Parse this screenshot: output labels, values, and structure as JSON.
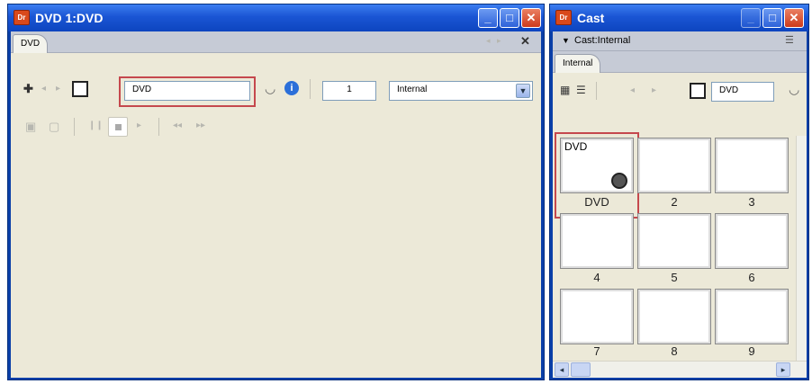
{
  "left_window": {
    "title": "DVD 1:DVD",
    "tab": "DVD",
    "name_field": "DVD",
    "number_field": "1",
    "cast_select": "Internal",
    "icons": [
      "plus-icon",
      "back-arrow-icon",
      "forward-arrow-icon",
      "sprite-square-icon",
      "eye-icon",
      "info-icon",
      "chevron-down-icon",
      "page-icon",
      "frame-icon",
      "pause-icon",
      "stop-icon",
      "play-icon",
      "rewind-icon",
      "fast-forward-icon"
    ]
  },
  "right_window": {
    "title": "Cast",
    "panel_header": "Cast:Internal",
    "tab": "Internal",
    "name_field": "DVD",
    "cells": [
      {
        "name": "DVD",
        "label": "DVD"
      },
      {
        "name": "",
        "label": "2"
      },
      {
        "name": "",
        "label": "3"
      },
      {
        "name": "",
        "label": "4"
      },
      {
        "name": "",
        "label": "5"
      },
      {
        "name": "",
        "label": "6"
      },
      {
        "name": "",
        "label": "7"
      },
      {
        "name": "",
        "label": "8"
      },
      {
        "name": "",
        "label": "9"
      }
    ]
  },
  "colors": {
    "titlebar": "#1a55d4",
    "highlight": "#c5484d",
    "client": "#ece9d8",
    "close_button": "#cd3a1b"
  }
}
